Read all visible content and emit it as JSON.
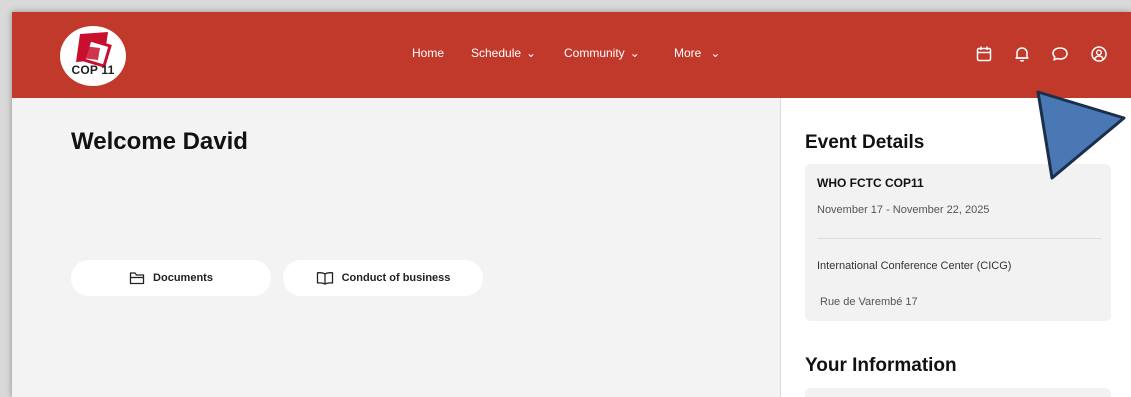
{
  "header": {
    "logo_text": "COP 11",
    "nav": [
      {
        "label": "Home",
        "has_chevron": false
      },
      {
        "label": "Schedule",
        "has_chevron": true
      },
      {
        "label": "Community",
        "has_chevron": true
      },
      {
        "label": "More",
        "has_chevron": true
      }
    ],
    "chevron": "⌄",
    "icons": [
      "calendar-icon",
      "bell-icon",
      "chat-icon",
      "user-circle-icon"
    ]
  },
  "main": {
    "welcome": "Welcome David",
    "buttons": [
      {
        "label": "Documents",
        "icon": "folder-icon"
      },
      {
        "label": "Conduct of business",
        "icon": "book-open-icon"
      }
    ]
  },
  "sidebar": {
    "event_title": "Event Details",
    "event": {
      "name": "WHO FCTC COP11",
      "dates": "November 17 - November 22, 2025",
      "venue": "International Conference Center (CICG)",
      "address": "Rue de Varembé 17"
    },
    "info_title": "Your Information"
  },
  "colors": {
    "header_bg": "#c0392b",
    "logo_red": "#c8102e",
    "pointer": "#4a78b4"
  }
}
